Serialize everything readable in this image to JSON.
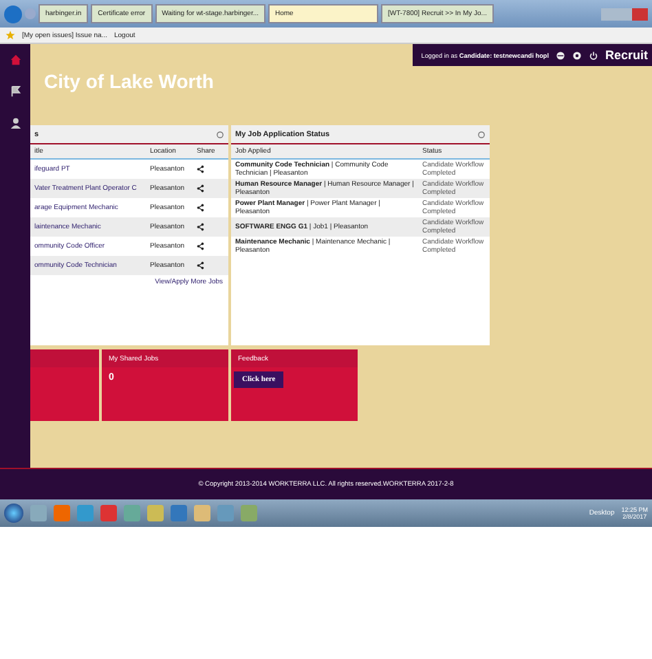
{
  "browser": {
    "tabs": [
      {
        "label": "harbinger.in",
        "selected": false
      },
      {
        "label": "Certificate error",
        "selected": false
      },
      {
        "label": "Waiting for wt-stage.harbinger...",
        "selected": false
      },
      {
        "label": "Home",
        "selected": true
      },
      {
        "label": "[WT-7800] Recruit >> In My Jo...",
        "selected": false
      }
    ],
    "favorites": [
      "[My open issues] Issue na...",
      "Logout"
    ]
  },
  "header": {
    "logged_in": "Logged in as",
    "role": "Candidate:",
    "user": "testnewcandi hopl",
    "app": "Recruit"
  },
  "title": "City of Lake Worth",
  "jobs_panel": {
    "title": "s",
    "columns": [
      "itle",
      "Location",
      "Share"
    ],
    "rows": [
      {
        "title": "ifeguard PT",
        "location": "Pleasanton"
      },
      {
        "title": "Vater Treatment Plant Operator C",
        "location": "Pleasanton"
      },
      {
        "title": "arage Equipment Mechanic",
        "location": "Pleasanton"
      },
      {
        "title": "laintenance Mechanic",
        "location": "Pleasanton"
      },
      {
        "title": "ommunity Code Officer",
        "location": "Pleasanton"
      },
      {
        "title": "ommunity Code Technician",
        "location": "Pleasanton"
      }
    ],
    "link": "View/Apply More Jobs"
  },
  "status_panel": {
    "title": "My Job Application Status",
    "columns": [
      "Job Applied",
      "Status"
    ],
    "rows": [
      {
        "job": "Community Code Technician",
        "detail": " | Community Code Technician | Pleasanton",
        "status": "Candidate Workflow Completed"
      },
      {
        "job": "Human Resource Manager",
        "detail": " | Human Resource Manager | Pleasanton",
        "status": "Candidate Workflow Completed"
      },
      {
        "job": "Power Plant Manager",
        "detail": " | Power Plant Manager | Pleasanton",
        "status": "Candidate Workflow Completed"
      },
      {
        "job": "SOFTWARE ENGG G1",
        "detail": " | Job1 | Pleasanton",
        "status": "Candidate Workflow Completed"
      },
      {
        "job": "Maintenance Mechanic",
        "detail": " | Maintenance Mechanic | Pleasanton",
        "status": "Candidate Workflow Completed"
      }
    ]
  },
  "tiles": [
    {
      "kind": "blank"
    },
    {
      "kind": "count",
      "label": "My Shared Jobs",
      "value": "0"
    },
    {
      "kind": "action",
      "label": "Feedback",
      "button": "Click here"
    }
  ],
  "footer": "© Copyright 2013-2014 WORKTERRA LLC. All rights reserved.WORKTERRA 2017-2-8",
  "taskbar": {
    "desktop": "Desktop",
    "time": "12:25 PM",
    "date": "2/8/2017"
  }
}
